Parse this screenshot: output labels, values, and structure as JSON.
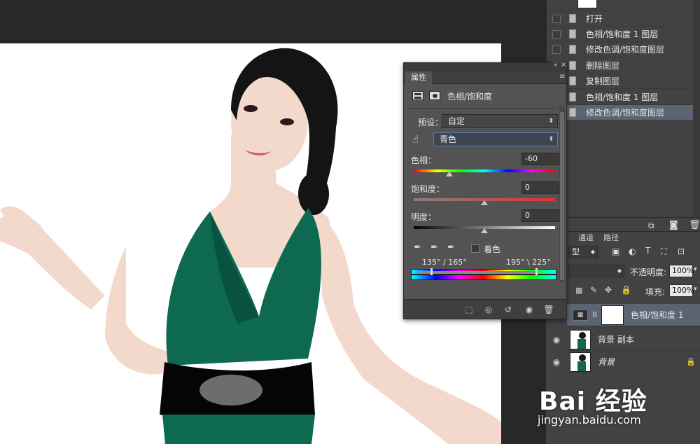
{
  "history": {
    "items": [
      {
        "label": "打开",
        "active": false
      },
      {
        "label": "色相/饱和度 1 图层",
        "active": false
      },
      {
        "label": "修改色调/饱和度图层",
        "active": false
      },
      {
        "label": "删除图层",
        "active": false
      },
      {
        "label": "复制图层",
        "active": false
      },
      {
        "label": "色相/饱和度 1 图层",
        "active": false
      },
      {
        "label": "修改色调/饱和度图层",
        "active": true
      }
    ]
  },
  "properties": {
    "tab_label": "属性",
    "title": "色相/饱和度",
    "preset_label": "预设：",
    "preset_value": "自定",
    "channel_value": "青色",
    "hue_label": "色相：",
    "hue_value": "-60",
    "hue_level": 0.25,
    "saturation_label": "饱和度：",
    "saturation_value": "0",
    "saturation_level": 0.5,
    "lightness_label": "明度：",
    "lightness_value": "0",
    "lightness_level": 0.5,
    "colorize_label": "着色",
    "colorize_checked": false,
    "range_left": "135° / 165°",
    "range_right": "195° \\ 225°"
  },
  "layers": {
    "tabs": [
      "通道",
      "路径"
    ],
    "filter_kind": "型",
    "opacity_label": "不透明度:",
    "opacity_value": "100%",
    "fill_label": "填充:",
    "fill_value": "100%",
    "rows": [
      {
        "name": "色相/饱和度 1",
        "active": true,
        "italic": false
      },
      {
        "name": "背景 副本",
        "active": false,
        "italic": false
      },
      {
        "name": "背景",
        "active": false,
        "italic": true
      }
    ]
  },
  "watermark": {
    "logo": "Bai 经验",
    "url": "jingyan.baidu.com"
  },
  "colors": {
    "panel_bg": "#535353",
    "selected_row": "#5b6473",
    "dress": "#0d6a50"
  }
}
